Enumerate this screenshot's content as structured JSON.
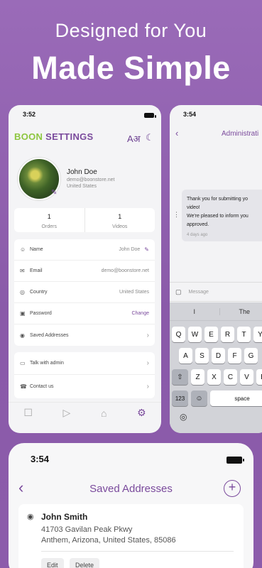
{
  "headline": {
    "line1": "Designed for You",
    "line2": "Made Simple"
  },
  "colors": {
    "accent": "#7a4a9c",
    "brand_green": "#8dc63f",
    "background": "#9a6bb8"
  },
  "settings_screen": {
    "status_time": "3:52",
    "logo_part1": "BOON",
    "logo_part2": "SETTINGS",
    "icons": [
      "translate-icon",
      "moon-icon"
    ],
    "profile": {
      "name": "John Doe",
      "email": "demo@boonstore.net",
      "country": "United States"
    },
    "stats": [
      {
        "value": "1",
        "label": "Orders"
      },
      {
        "value": "1",
        "label": "Videos"
      }
    ],
    "fields": [
      {
        "icon": "user-icon",
        "label": "Name",
        "value": "John Doe",
        "action_icon": "pencil-icon"
      },
      {
        "icon": "mail-icon",
        "label": "Email",
        "value": "demo@boonstore.net"
      },
      {
        "icon": "globe-icon",
        "label": "Country",
        "value": "United States"
      },
      {
        "icon": "lock-icon",
        "label": "Password",
        "action": "Change"
      },
      {
        "icon": "pin-icon",
        "label": "Saved Addresses"
      }
    ],
    "links": [
      {
        "icon": "chat-icon",
        "label": "Talk with admin"
      },
      {
        "icon": "phone-icon",
        "label": "Contact us"
      }
    ],
    "tabs": [
      "gift-icon",
      "video-icon",
      "basket-icon",
      "gear-icon"
    ]
  },
  "chat_screen": {
    "status_time": "3:54",
    "title": "Administrati",
    "message_lines": [
      "Thank you for submitting yo",
      "video!",
      "We're pleased to inform you",
      "approved."
    ],
    "message_time": "4 days ago",
    "input_placeholder": "Message",
    "suggestions": [
      "I",
      "The"
    ],
    "keyboard_rows": [
      [
        "Q",
        "W",
        "E",
        "R",
        "T",
        "Y"
      ],
      [
        "A",
        "S",
        "D",
        "F",
        "G"
      ],
      [
        "Z",
        "X",
        "C",
        "V",
        "B"
      ]
    ],
    "key_123": "123",
    "key_space": "space"
  },
  "addresses_screen": {
    "status_time": "3:54",
    "title": "Saved Addresses",
    "address": {
      "name": "John Smith",
      "line1": "41703 Gavilan Peak Pkwy",
      "line2": "Anthem, Arizona, United States, 85086"
    },
    "edit_label": "Edit",
    "delete_label": "Delete"
  }
}
